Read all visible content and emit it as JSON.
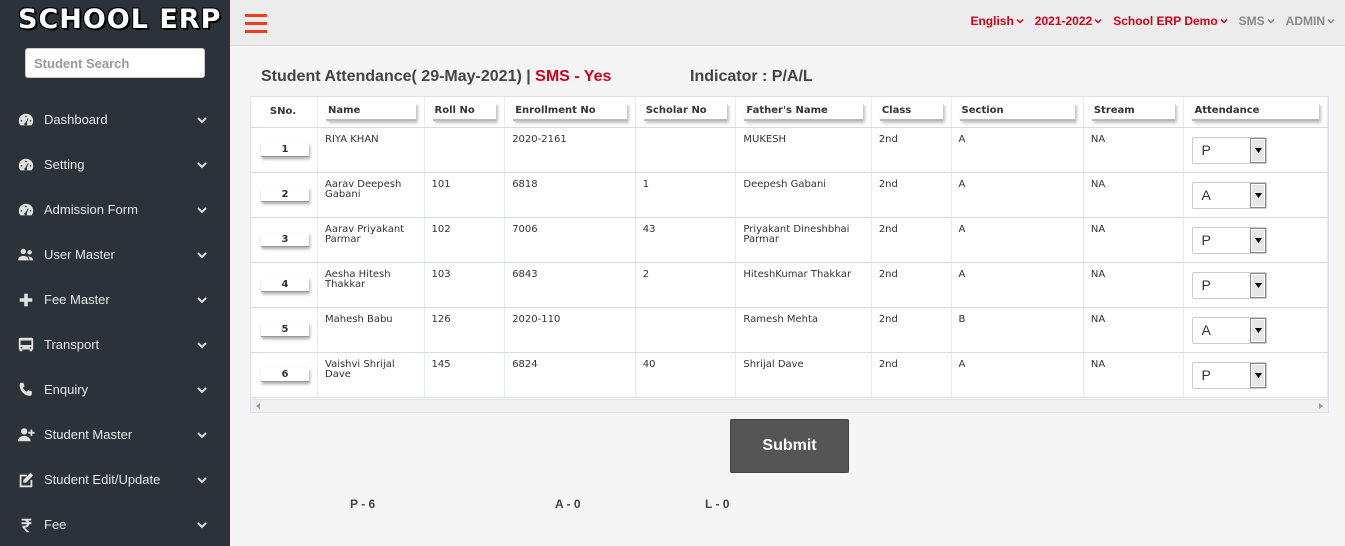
{
  "sidebar": {
    "logo": "SCHOOL ERP",
    "search_placeholder": "Student Search",
    "items": [
      {
        "label": "Dashboard",
        "icon": "dashboard-icon"
      },
      {
        "label": "Setting",
        "icon": "dashboard-icon"
      },
      {
        "label": "Admission Form",
        "icon": "dashboard-icon"
      },
      {
        "label": "User Master",
        "icon": "users-icon"
      },
      {
        "label": "Fee Master",
        "icon": "plus-icon"
      },
      {
        "label": "Transport",
        "icon": "bus-icon"
      },
      {
        "label": "Enquiry",
        "icon": "phone-icon"
      },
      {
        "label": "Student Master",
        "icon": "user-plus-icon"
      },
      {
        "label": "Student Edit/Update",
        "icon": "edit-icon"
      },
      {
        "label": "Fee",
        "icon": "rupee-icon"
      }
    ]
  },
  "topbar": {
    "language": "English",
    "session": "2021-2022",
    "school": "School ERP Demo",
    "sms": "SMS",
    "user": "ADMIN"
  },
  "main": {
    "heading": "Student Attendance( 29-May-2021) | ",
    "sms_status": "SMS - Yes",
    "indicator": "Indicator : P/A/L",
    "columns": [
      "SNo.",
      "Name",
      "Roll No",
      "Enrollment No",
      "Scholar No",
      "Father's Name",
      "Class",
      "Section",
      "Stream",
      "Attendance"
    ],
    "rows": [
      {
        "sno": "1",
        "name": "RIYA KHAN",
        "roll": "",
        "enroll": "2020-2161",
        "scholar": "",
        "father": "MUKESH",
        "class": "2nd",
        "section": "A",
        "stream": "NA",
        "attendance": "P"
      },
      {
        "sno": "2",
        "name": "Aarav Deepesh Gabani",
        "roll": "101",
        "enroll": "6818",
        "scholar": "1",
        "father": "Deepesh Gabani",
        "class": "2nd",
        "section": "A",
        "stream": "NA",
        "attendance": "A"
      },
      {
        "sno": "3",
        "name": "Aarav Priyakant Parmar",
        "roll": "102",
        "enroll": "7006",
        "scholar": "43",
        "father": "Priyakant Dineshbhai Parmar",
        "class": "2nd",
        "section": "A",
        "stream": "NA",
        "attendance": "P"
      },
      {
        "sno": "4",
        "name": "Aesha Hitesh Thakkar",
        "roll": "103",
        "enroll": "6843",
        "scholar": "2",
        "father": "HiteshKumar Thakkar",
        "class": "2nd",
        "section": "A",
        "stream": "NA",
        "attendance": "P"
      },
      {
        "sno": "5",
        "name": "Mahesh Babu",
        "roll": "126",
        "enroll": "2020-110",
        "scholar": "",
        "father": "Ramesh Mehta",
        "class": "2nd",
        "section": "B",
        "stream": "NA",
        "attendance": "A"
      },
      {
        "sno": "6",
        "name": "Vaishvi Shrijal Dave",
        "roll": "145",
        "enroll": "6824",
        "scholar": "40",
        "father": "Shrijal Dave",
        "class": "2nd",
        "section": "A",
        "stream": "NA",
        "attendance": "P"
      }
    ],
    "submit_label": "Submit",
    "summary": {
      "present": "P - 6",
      "absent": "A - 0",
      "leave": "L - 0"
    }
  },
  "colors": {
    "sidebar_bg": "#2c3338",
    "accent_red": "#d0021b",
    "hamburger": "#e8421e",
    "button_bg": "#555555"
  }
}
